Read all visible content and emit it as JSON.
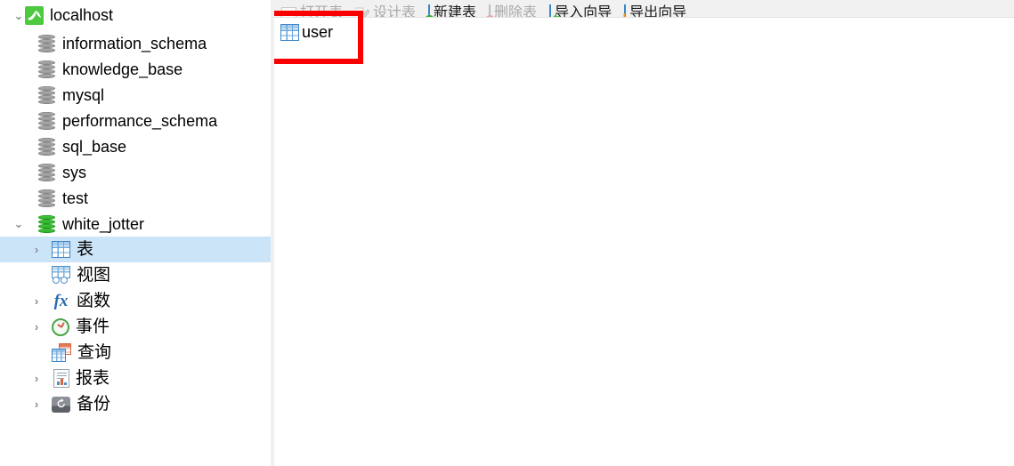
{
  "app": {
    "accent_selection": "#cce4f7",
    "annotation_color": "#fc0000"
  },
  "toolbar": {
    "items": [
      {
        "label": "打开表",
        "icon": "open-table-icon",
        "enabled": false
      },
      {
        "label": "设计表",
        "icon": "design-table-icon",
        "enabled": false
      },
      {
        "label": "新建表",
        "icon": "new-table-icon",
        "enabled": true
      },
      {
        "label": "删除表",
        "icon": "delete-table-icon",
        "enabled": false
      },
      {
        "label": "导入向导",
        "icon": "import-wizard-icon",
        "enabled": true
      },
      {
        "label": "导出向导",
        "icon": "export-wizard-icon",
        "enabled": true
      }
    ]
  },
  "sidebar": {
    "connection": {
      "label": "localhost",
      "icon": "mysql-dolphin-icon",
      "expanded": true
    },
    "databases": [
      {
        "label": "information_schema",
        "icon": "database-icon"
      },
      {
        "label": "knowledge_base",
        "icon": "database-icon"
      },
      {
        "label": "mysql",
        "icon": "database-icon"
      },
      {
        "label": "performance_schema",
        "icon": "database-icon"
      },
      {
        "label": "sql_base",
        "icon": "database-icon"
      },
      {
        "label": "sys",
        "icon": "database-icon"
      },
      {
        "label": "test",
        "icon": "database-icon"
      }
    ],
    "active_database": {
      "label": "white_jotter",
      "icon": "database-open-icon",
      "expanded": true
    },
    "objects": [
      {
        "label": "表",
        "icon": "table-icon",
        "expandable": true,
        "selected": true
      },
      {
        "label": "视图",
        "icon": "view-icon",
        "expandable": false,
        "selected": false
      },
      {
        "label": "函数",
        "icon": "function-icon",
        "expandable": true,
        "selected": false
      },
      {
        "label": "事件",
        "icon": "event-icon",
        "expandable": true,
        "selected": false
      },
      {
        "label": "查询",
        "icon": "query-icon",
        "expandable": false,
        "selected": false
      },
      {
        "label": "报表",
        "icon": "report-icon",
        "expandable": true,
        "selected": false
      },
      {
        "label": "备份",
        "icon": "backup-icon",
        "expandable": true,
        "selected": false
      }
    ]
  },
  "content": {
    "items": [
      {
        "label": "user",
        "icon": "table-icon",
        "highlighted": true
      }
    ]
  }
}
